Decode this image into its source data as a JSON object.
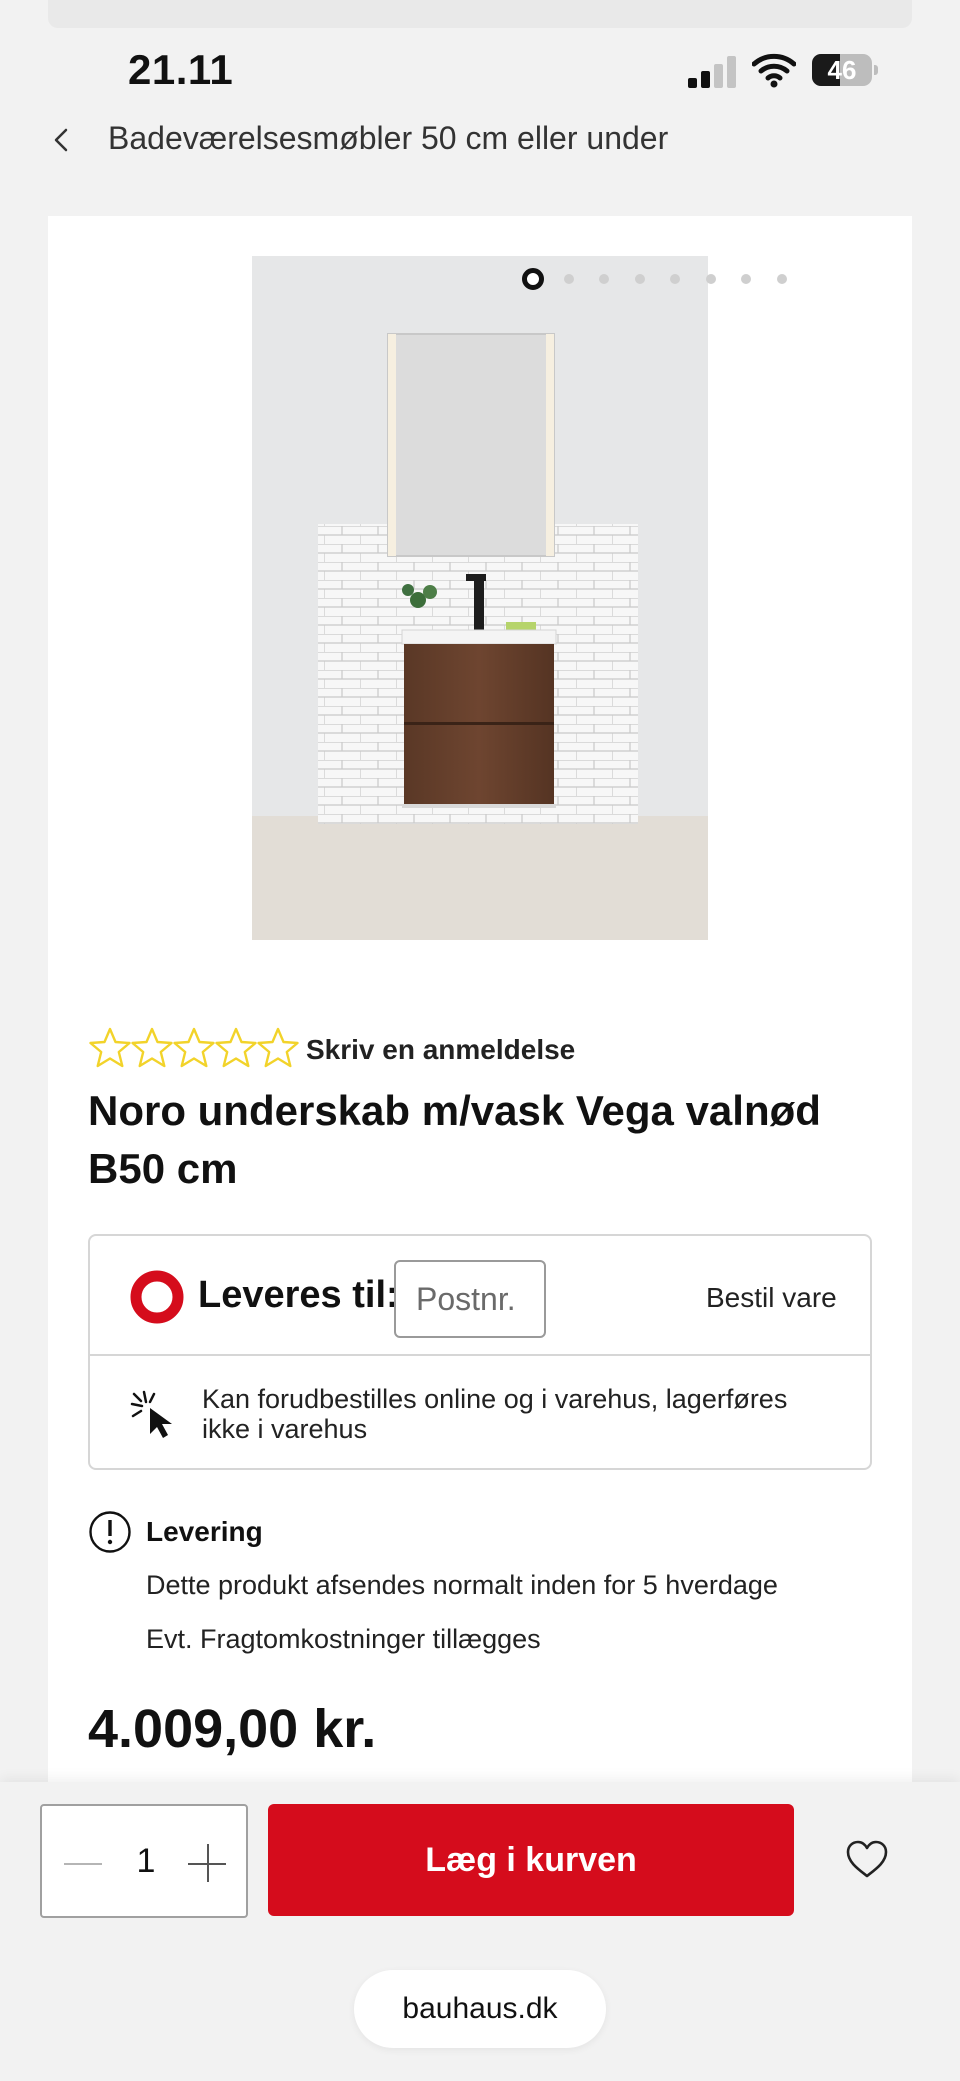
{
  "status_bar": {
    "time": "21.11",
    "battery_level": "46",
    "signal_bars_active": 2,
    "icons": [
      "signal-icon",
      "wifi-icon",
      "battery-icon"
    ]
  },
  "header": {
    "back_icon": "chevron-left-icon",
    "title": "Badeværelsesmøbler 50 cm eller under"
  },
  "gallery": {
    "image_subject": "bathroom vanity with walnut cabinet, sink and mirror cabinet",
    "dot_count": 8,
    "active_dot": 1
  },
  "product": {
    "rating_stars": 0,
    "review_link": "Skriv en anmeldelse",
    "title": "Noro underskab m/vask Vega valnød B50 cm",
    "price": "4.009,00 kr."
  },
  "delivery": {
    "label": "Leveres til:",
    "postnr_placeholder": "Postnr.",
    "postnr_value": "",
    "order_label": "Bestil vare",
    "preorder_text": "Kan forudbestilles online og i varehus, lagerføres ikke i varehus"
  },
  "levering": {
    "title": "Levering",
    "line1": "Dette produkt afsendes normalt inden for 5 hverdage",
    "line2": "Evt. Fragtomkostninger tillægges"
  },
  "cart": {
    "quantity": "1",
    "add_label": "Læg i kurven",
    "favorite_icon": "heart-icon"
  },
  "browser": {
    "url": "bauhaus.dk"
  },
  "colors": {
    "accent_red": "#d50c1c",
    "star_outline": "#f2d32a",
    "page_bg": "#f2f2f2"
  }
}
